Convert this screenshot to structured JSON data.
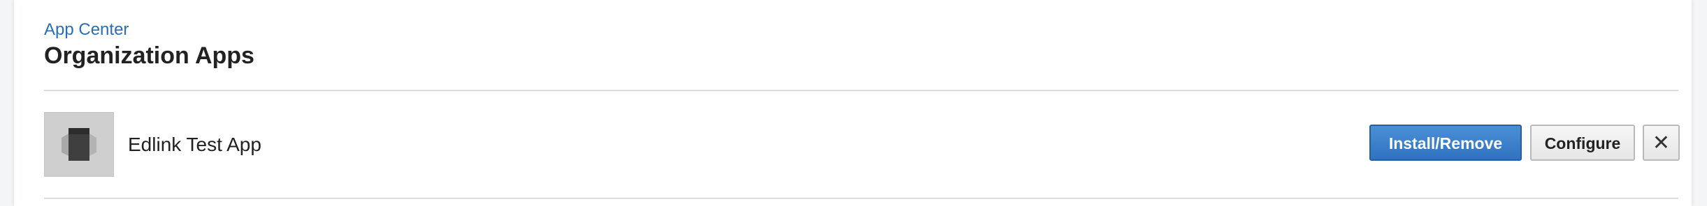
{
  "header": {
    "breadcrumb": "App Center",
    "title": "Organization Apps"
  },
  "apps": [
    {
      "name": "Edlink Test App",
      "icon": "app-placeholder-icon",
      "actions": {
        "install_remove_label": "Install/Remove",
        "configure_label": "Configure",
        "close_label": "✕"
      }
    }
  ],
  "colors": {
    "link": "#2a6fb5",
    "primary": "#3a80cc",
    "divider": "#dcdcdc"
  }
}
